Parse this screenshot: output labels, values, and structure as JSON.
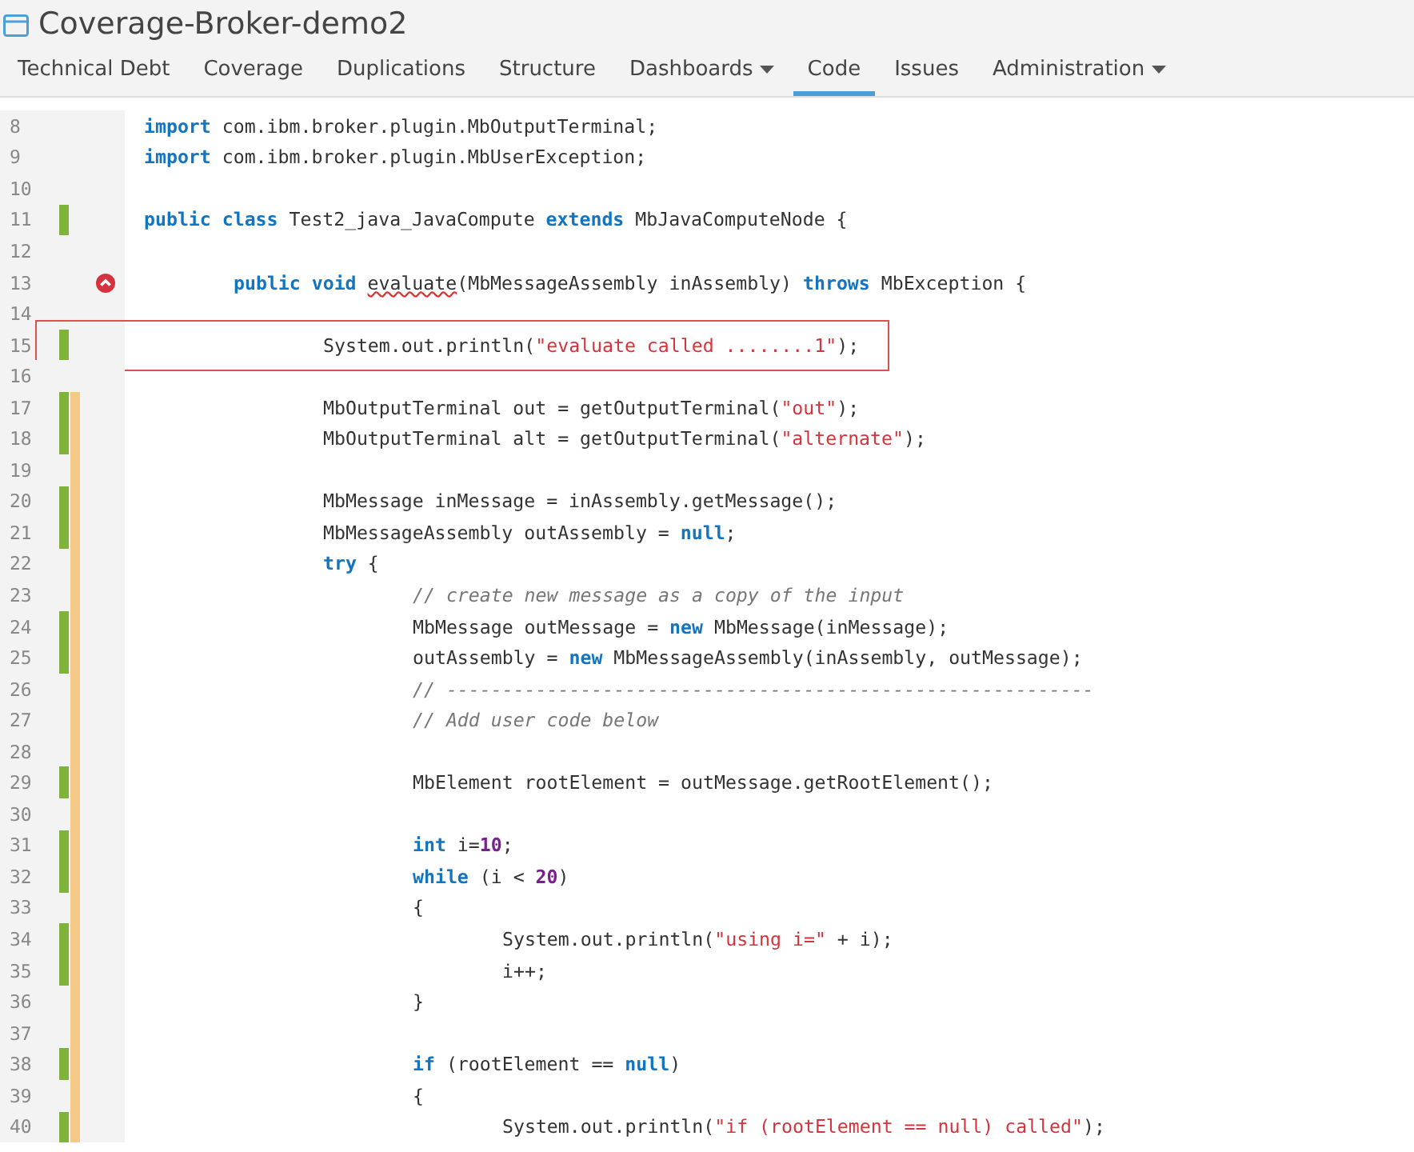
{
  "project": {
    "title": "Coverage-Broker-demo2"
  },
  "tabs": [
    {
      "label": "Technical Debt",
      "selected": false,
      "dropdown": false
    },
    {
      "label": "Coverage",
      "selected": false,
      "dropdown": false
    },
    {
      "label": "Duplications",
      "selected": false,
      "dropdown": false
    },
    {
      "label": "Structure",
      "selected": false,
      "dropdown": false
    },
    {
      "label": "Dashboards",
      "selected": false,
      "dropdown": true
    },
    {
      "label": "Code",
      "selected": true,
      "dropdown": false
    },
    {
      "label": "Issues",
      "selected": false,
      "dropdown": false
    },
    {
      "label": "Administration",
      "selected": false,
      "dropdown": true
    }
  ],
  "lines": [
    {
      "number": "8",
      "covered": false,
      "branch": false,
      "issue": false,
      "highlighted": false,
      "tokens": [
        {
          "t": "import",
          "kind": "kw"
        },
        {
          "t": " com.ibm.broker.plugin.MbOutputTerminal;",
          "kind": "plain"
        }
      ]
    },
    {
      "number": "9",
      "covered": false,
      "branch": false,
      "issue": false,
      "highlighted": false,
      "tokens": [
        {
          "t": "import",
          "kind": "kw"
        },
        {
          "t": " com.ibm.broker.plugin.MbUserException;",
          "kind": "plain"
        }
      ]
    },
    {
      "number": "10",
      "covered": false,
      "branch": false,
      "issue": false,
      "highlighted": false
    },
    {
      "number": "11",
      "covered": true,
      "branch": false,
      "issue": false,
      "highlighted": false,
      "tokens": [
        {
          "t": "public class",
          "kind": "kw"
        },
        {
          "t": " Test2_java_JavaCompute ",
          "kind": "plain"
        },
        {
          "t": "extends",
          "kind": "kw"
        },
        {
          "t": " MbJavaComputeNode {",
          "kind": "plain"
        }
      ],
      "children": [
        {
          "number": "12",
          "covered": false,
          "branch": false,
          "issue": false,
          "highlighted": false
        },
        {
          "number": "13",
          "covered": false,
          "branch": false,
          "issue": true,
          "highlighted": false,
          "tokens": [
            {
              "t": "public void ",
              "kind": "kw"
            },
            {
              "t": "evaluate",
              "kind": "warn"
            },
            {
              "t": "(MbMessageAssembly inAssembly) ",
              "kind": "plain"
            },
            {
              "t": "throws",
              "kind": "kw"
            },
            {
              "t": " MbException {",
              "kind": "plain"
            }
          ],
          "children": [
            {
              "number": "14",
              "covered": false,
              "branch": false,
              "issue": false,
              "highlighted": false
            },
            {
              "number": "15",
              "covered": true,
              "branch": false,
              "issue": false,
              "highlighted": true,
              "tokens": [
                {
                  "t": "System.out.println(",
                  "kind": "plain"
                },
                {
                  "t": "\"evaluate called ........1\"",
                  "kind": "str"
                },
                {
                  "t": ");",
                  "kind": "plain"
                }
              ]
            },
            {
              "number": "16",
              "covered": false,
              "branch": false,
              "issue": false,
              "highlighted": false
            },
            {
              "number": "17",
              "covered": true,
              "branch": true,
              "issue": false,
              "highlighted": false,
              "tokens": [
                {
                  "t": "MbOutputTerminal out = getOutputTerminal(",
                  "kind": "plain"
                },
                {
                  "t": "\"out\"",
                  "kind": "str"
                },
                {
                  "t": ");",
                  "kind": "plain"
                }
              ]
            },
            {
              "number": "18",
              "covered": true,
              "branch": true,
              "issue": false,
              "highlighted": false,
              "tokens": [
                {
                  "t": "MbOutputTerminal alt = getOutputTerminal(",
                  "kind": "plain"
                },
                {
                  "t": "\"alternate\"",
                  "kind": "str"
                },
                {
                  "t": ");",
                  "kind": "plain"
                }
              ]
            },
            {
              "number": "19",
              "covered": false,
              "branch": true,
              "issue": false,
              "highlighted": false
            },
            {
              "number": "20",
              "covered": true,
              "branch": true,
              "issue": false,
              "highlighted": false,
              "tokens": [
                {
                  "t": "MbMessage inMessage = inAssembly.getMessage();",
                  "kind": "plain"
                }
              ]
            },
            {
              "number": "21",
              "covered": true,
              "branch": true,
              "issue": false,
              "highlighted": false,
              "tokens": [
                {
                  "t": "MbMessageAssembly outAssembly = ",
                  "kind": "plain"
                },
                {
                  "t": "null",
                  "kind": "kw"
                },
                {
                  "t": ";",
                  "kind": "plain"
                }
              ]
            },
            {
              "number": "22",
              "covered": false,
              "branch": true,
              "issue": false,
              "highlighted": false,
              "tokens": [
                {
                  "t": "try",
                  "kind": "kw"
                },
                {
                  "t": " {",
                  "kind": "plain"
                }
              ],
              "children": [
                {
                  "number": "23",
                  "covered": false,
                  "branch": true,
                  "issue": false,
                  "highlighted": false,
                  "tokens": [
                    {
                      "t": "// create new message as a copy of the input",
                      "kind": "com"
                    }
                  ]
                },
                {
                  "number": "24",
                  "covered": true,
                  "branch": true,
                  "issue": false,
                  "highlighted": false,
                  "tokens": [
                    {
                      "t": "MbMessage outMessage = ",
                      "kind": "plain"
                    },
                    {
                      "t": "new",
                      "kind": "kw"
                    },
                    {
                      "t": " MbMessage(inMessage);",
                      "kind": "plain"
                    }
                  ]
                },
                {
                  "number": "25",
                  "covered": true,
                  "branch": true,
                  "issue": false,
                  "highlighted": false,
                  "tokens": [
                    {
                      "t": "outAssembly = ",
                      "kind": "plain"
                    },
                    {
                      "t": "new",
                      "kind": "kw"
                    },
                    {
                      "t": " MbMessageAssembly(inAssembly, outMessage);",
                      "kind": "plain"
                    }
                  ]
                },
                {
                  "number": "26",
                  "covered": false,
                  "branch": true,
                  "issue": false,
                  "highlighted": false,
                  "tokens": [
                    {
                      "t": "// ----------------------------------------------------------",
                      "kind": "com"
                    }
                  ]
                },
                {
                  "number": "27",
                  "covered": false,
                  "branch": true,
                  "issue": false,
                  "highlighted": false,
                  "tokens": [
                    {
                      "t": "// Add user code below",
                      "kind": "com"
                    }
                  ]
                },
                {
                  "number": "28",
                  "covered": false,
                  "branch": true,
                  "issue": false,
                  "highlighted": false
                },
                {
                  "number": "29",
                  "covered": true,
                  "branch": true,
                  "issue": false,
                  "highlighted": false,
                  "tokens": [
                    {
                      "t": "MbElement rootElement = outMessage.getRootElement();",
                      "kind": "plain"
                    }
                  ]
                },
                {
                  "number": "30",
                  "covered": false,
                  "branch": true,
                  "issue": false,
                  "highlighted": false
                },
                {
                  "number": "31",
                  "covered": true,
                  "branch": true,
                  "issue": false,
                  "highlighted": false,
                  "tokens": [
                    {
                      "t": "int",
                      "kind": "kw"
                    },
                    {
                      "t": " i=",
                      "kind": "plain"
                    },
                    {
                      "t": "10",
                      "kind": "num"
                    },
                    {
                      "t": ";",
                      "kind": "plain"
                    }
                  ]
                },
                {
                  "number": "32",
                  "covered": true,
                  "branch": true,
                  "issue": false,
                  "highlighted": false,
                  "tokens": [
                    {
                      "t": "while",
                      "kind": "kw"
                    },
                    {
                      "t": " (i < ",
                      "kind": "plain"
                    },
                    {
                      "t": "20",
                      "kind": "num"
                    },
                    {
                      "t": ")",
                      "kind": "plain"
                    }
                  ]
                },
                {
                  "number": "33",
                  "covered": false,
                  "branch": true,
                  "issue": false,
                  "highlighted": false,
                  "tokens": [
                    {
                      "t": "{",
                      "kind": "plain"
                    }
                  ],
                  "children": [
                    {
                      "number": "34",
                      "covered": true,
                      "branch": true,
                      "issue": false,
                      "highlighted": false,
                      "tokens": [
                        {
                          "t": "System.out.println(",
                          "kind": "plain"
                        },
                        {
                          "t": "\"using i=\"",
                          "kind": "str"
                        },
                        {
                          "t": " + i);",
                          "kind": "plain"
                        }
                      ]
                    },
                    {
                      "number": "35",
                      "covered": true,
                      "branch": true,
                      "issue": false,
                      "highlighted": false,
                      "tokens": [
                        {
                          "t": "i++;",
                          "kind": "plain"
                        }
                      ]
                    }
                  ]
                },
                {
                  "number": "36",
                  "covered": false,
                  "branch": true,
                  "issue": false,
                  "highlighted": false,
                  "tokens": [
                    {
                      "t": "}",
                      "kind": "plain"
                    }
                  ]
                },
                {
                  "number": "37",
                  "covered": false,
                  "branch": true,
                  "issue": false,
                  "highlighted": false
                },
                {
                  "number": "38",
                  "covered": true,
                  "branch": true,
                  "issue": false,
                  "highlighted": false,
                  "tokens": [
                    {
                      "t": "if",
                      "kind": "kw"
                    },
                    {
                      "t": " (rootElement == ",
                      "kind": "plain"
                    },
                    {
                      "t": "null",
                      "kind": "kw"
                    },
                    {
                      "t": ")",
                      "kind": "plain"
                    }
                  ]
                },
                {
                  "number": "39",
                  "covered": false,
                  "branch": true,
                  "issue": false,
                  "highlighted": false,
                  "tokens": [
                    {
                      "t": "{",
                      "kind": "plain"
                    }
                  ],
                  "children": [
                    {
                      "number": "40",
                      "covered": true,
                      "branch": true,
                      "issue": false,
                      "highlighted": false,
                      "tokens": [
                        {
                          "t": "System.out.println(",
                          "kind": "plain"
                        },
                        {
                          "t": "\"if (rootElement == null) called\"",
                          "kind": "str"
                        },
                        {
                          "t": ");",
                          "kind": "plain"
                        }
                      ]
                    }
                  ]
                }
              ]
            }
          ]
        }
      ]
    }
  ]
}
